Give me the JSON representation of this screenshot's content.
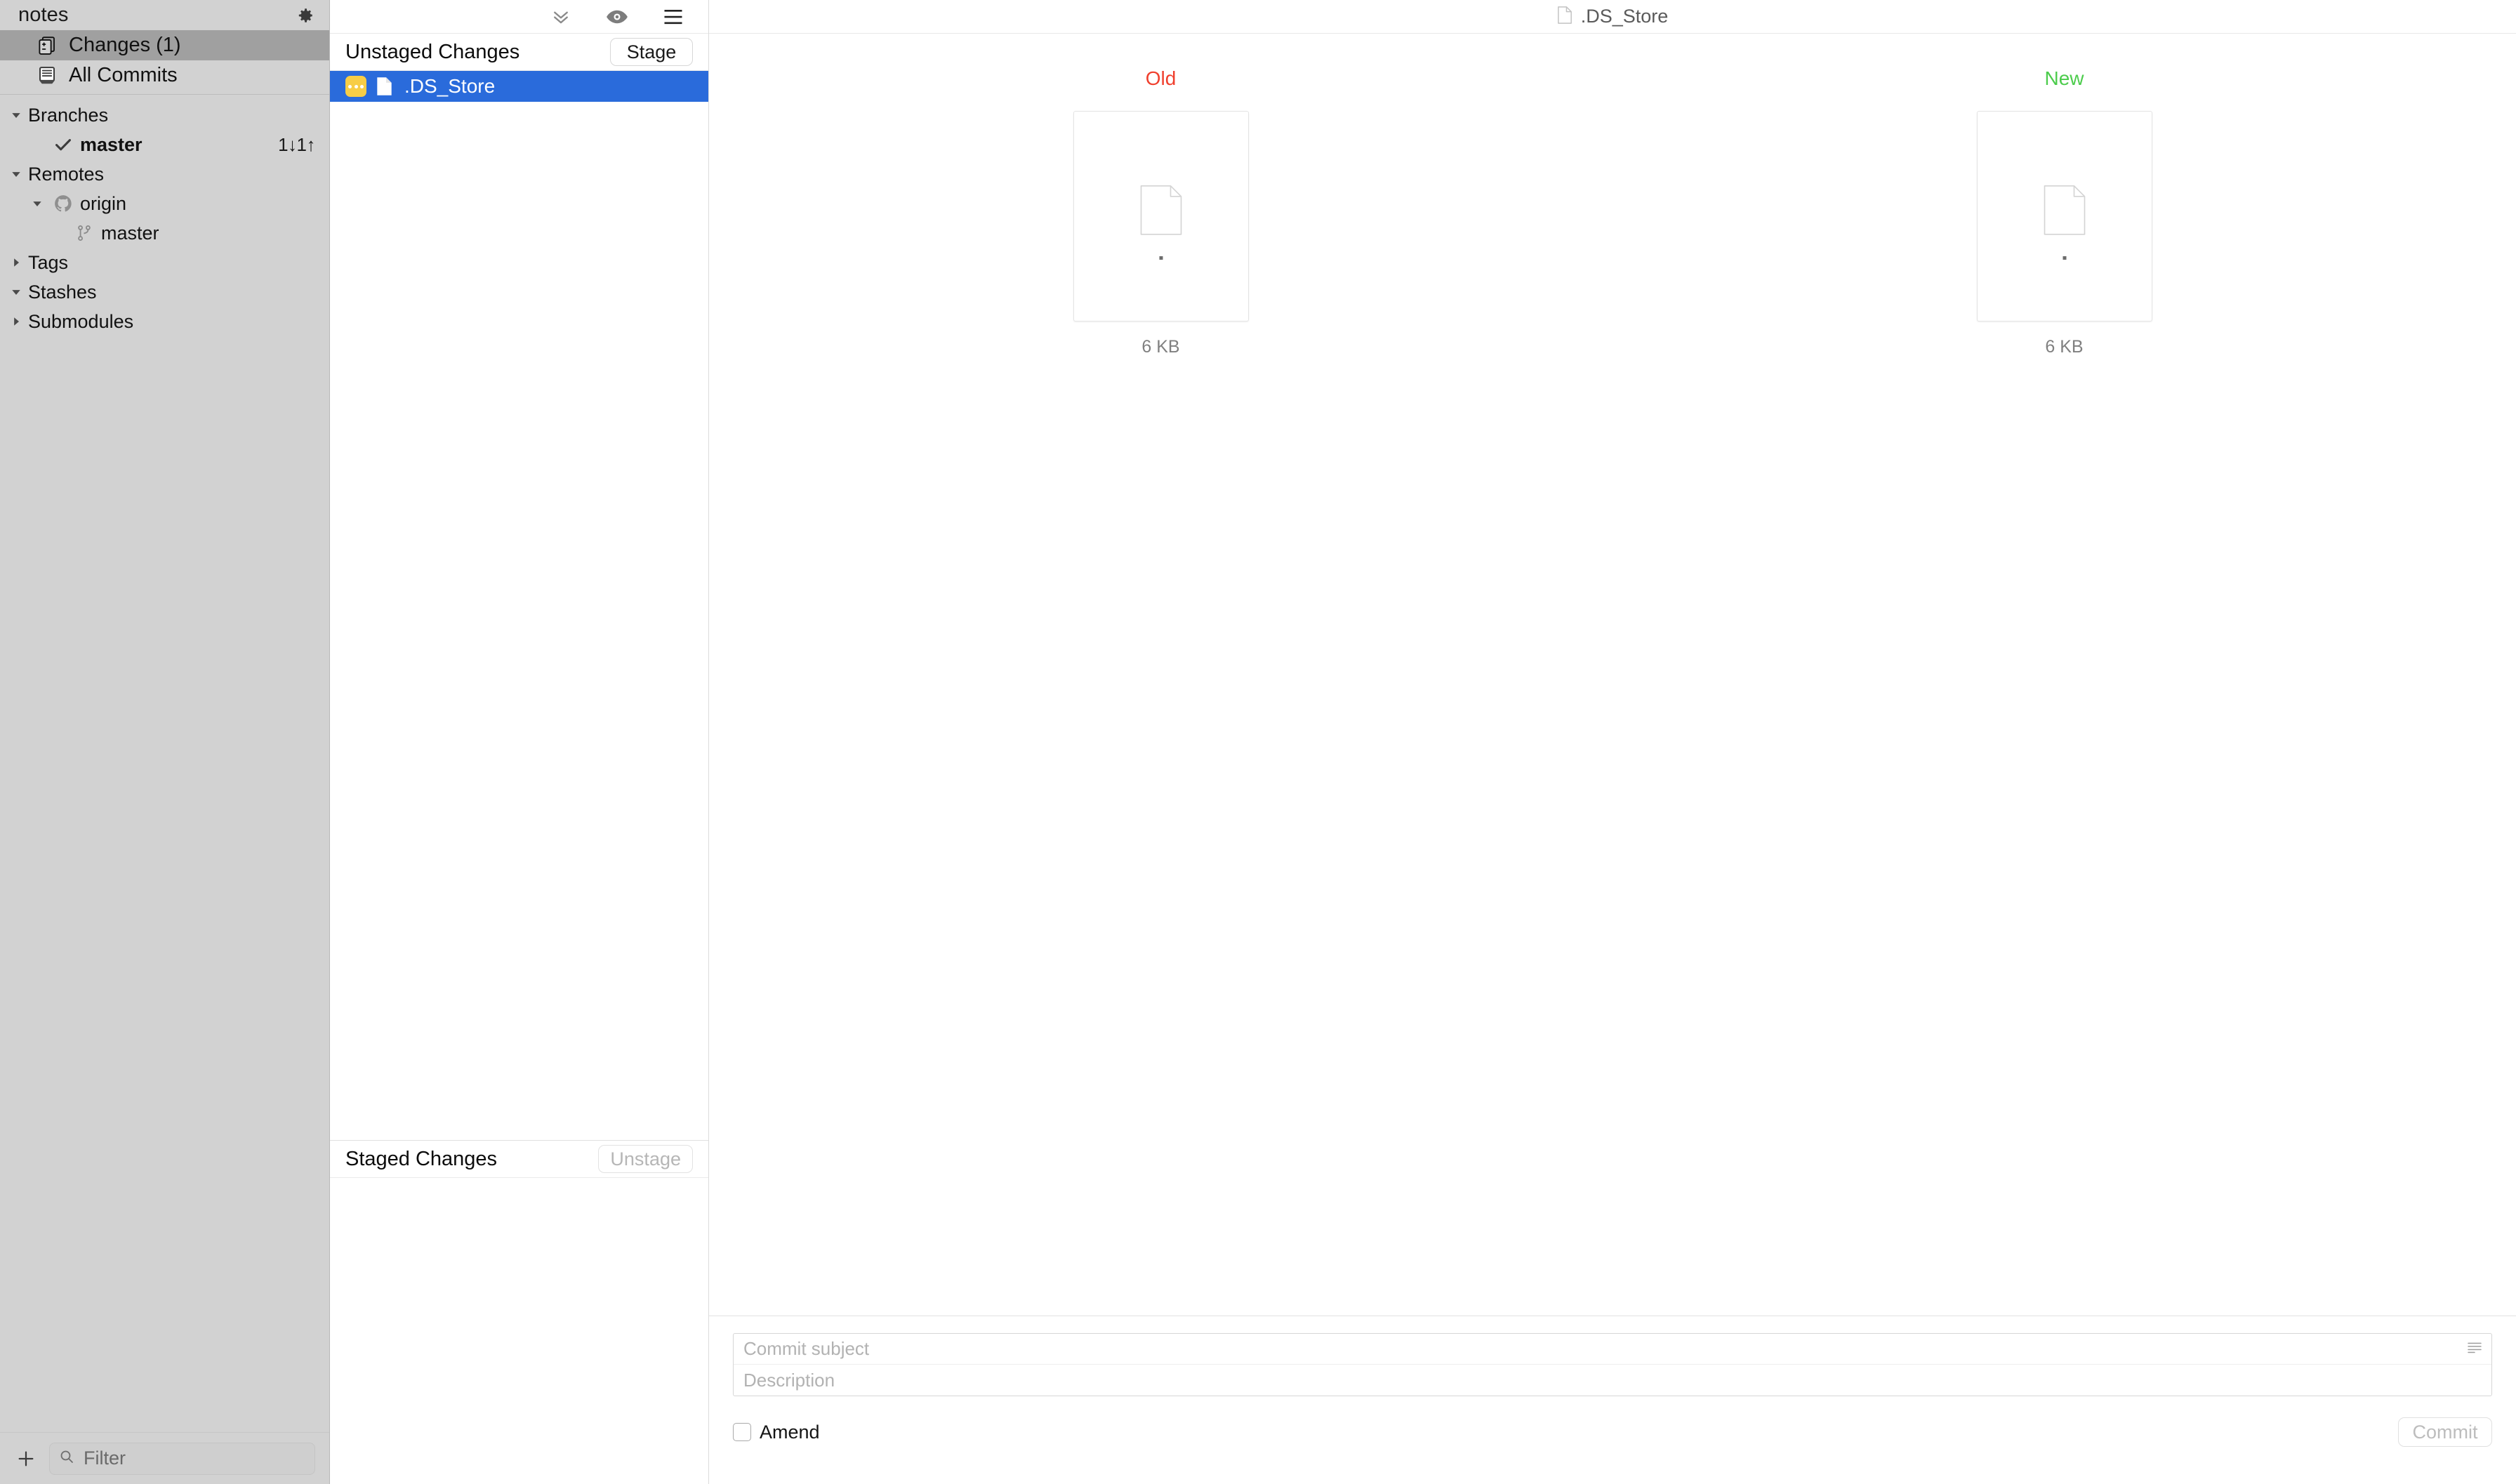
{
  "sidebar": {
    "repo_title": "notes",
    "gear_icon": "gear-icon",
    "top_items": [
      {
        "label": "Changes (1)",
        "icon": "changes-icon",
        "selected": true
      },
      {
        "label": "All Commits",
        "icon": "commits-icon",
        "selected": false
      }
    ],
    "tree": [
      {
        "label": "Branches",
        "level": 0,
        "twisty": "down",
        "icon": null,
        "count": null,
        "bold": false
      },
      {
        "label": "master",
        "level": 1,
        "twisty": null,
        "icon": "check-icon",
        "count": "1↓1↑",
        "bold": true
      },
      {
        "label": "Remotes",
        "level": 0,
        "twisty": "down",
        "icon": null,
        "count": null,
        "bold": false
      },
      {
        "label": "origin",
        "level": 1,
        "twisty": "down",
        "icon": "github-icon",
        "count": null,
        "bold": false
      },
      {
        "label": "master",
        "level": 2,
        "twisty": null,
        "icon": "branch-icon",
        "count": null,
        "bold": false
      },
      {
        "label": "Tags",
        "level": 0,
        "twisty": "right",
        "icon": null,
        "count": null,
        "bold": false
      },
      {
        "label": "Stashes",
        "level": 0,
        "twisty": "down",
        "icon": null,
        "count": null,
        "bold": false
      },
      {
        "label": "Submodules",
        "level": 0,
        "twisty": "right",
        "icon": null,
        "count": null,
        "bold": false
      }
    ],
    "footer": {
      "add_icon": "plus-icon",
      "search_icon": "search-icon",
      "filter_placeholder": "Filter"
    }
  },
  "middle": {
    "toolbar_icons": [
      "chevron-double-down-icon",
      "eye-icon",
      "hamburger-menu-icon"
    ],
    "unstaged": {
      "title": "Unstaged Changes",
      "action_label": "Stage",
      "action_enabled": true,
      "files": [
        {
          "name": ".DS_Store",
          "status": "modified",
          "selected": true
        }
      ]
    },
    "staged": {
      "title": "Staged Changes",
      "action_label": "Unstage",
      "action_enabled": false,
      "files": []
    }
  },
  "diff": {
    "file_icon": "document-icon",
    "file_name": ".DS_Store",
    "panes": [
      {
        "label": "Old",
        "color": "#f0402e",
        "size": "6 KB",
        "preview_icon": "document-icon"
      },
      {
        "label": "New",
        "color": "#4ccc4c",
        "size": "6 KB",
        "preview_icon": "document-icon"
      }
    ]
  },
  "commit": {
    "subject_placeholder": "Commit subject",
    "subject_value": "",
    "description_placeholder": "Description",
    "description_value": "",
    "menu_icon": "text-lines-icon",
    "amend_label": "Amend",
    "amend_checked": false,
    "commit_label": "Commit",
    "commit_enabled": false
  },
  "colors": {
    "selection_blue": "#2a6bdb",
    "modified_yellow": "#f7cd46",
    "old_red": "#f0402e",
    "new_green": "#4ccc4c",
    "sidebar_bg": "#d2d2d2",
    "sidebar_selected": "#a0a0a0"
  }
}
